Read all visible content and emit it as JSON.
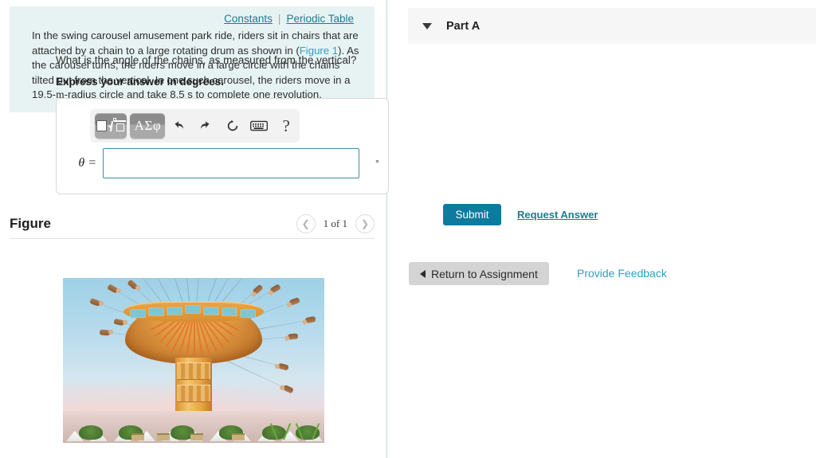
{
  "left_panel": {
    "top_links": [
      {
        "label": "Constants",
        "name": "constants-link"
      },
      {
        "label": "Periodic Table",
        "name": "periodic-table-link"
      }
    ],
    "separator": "|",
    "problem": {
      "part1": "In the swing carousel amusement park ride, riders sit in chairs that are attached by a chain to a large rotating drum as shown in (",
      "figure_link": "Figure 1",
      "part2": "). As the carousel turns, the riders move in a large circle with the chains tilted out from the vertical. In one such carousel, the riders move in a ",
      "radius_value": "19.5",
      "radius_unit": "m",
      "part3": "-radius circle and take ",
      "time_value": "8.5 s",
      "part4": " to complete one revolution."
    },
    "figure": {
      "title": "Figure",
      "prev_icon": "chevron-left-icon",
      "next_icon": "chevron-right-icon",
      "counter": "1 of 1",
      "image_alt": "swing carousel amusement park ride photograph"
    }
  },
  "right_panel": {
    "part": {
      "caret_icon": "caret-down-icon",
      "title": "Part A"
    },
    "question_text": "What is the angle of the chains, as measured from the vertical?",
    "instruction": "Express your answer in degrees.",
    "answer_widget": {
      "toolbar": [
        {
          "name": "math-template-button",
          "icon": "math-template-icon",
          "label": ""
        },
        {
          "name": "greek-symbols-button",
          "icon": "greek-letters-icon",
          "label": "ΑΣφ"
        },
        {
          "name": "undo-button",
          "icon": "undo-icon",
          "label": ""
        },
        {
          "name": "redo-button",
          "icon": "redo-icon",
          "label": ""
        },
        {
          "name": "reset-button",
          "icon": "reset-icon",
          "label": ""
        },
        {
          "name": "keyboard-button",
          "icon": "keyboard-icon",
          "label": ""
        },
        {
          "name": "help-button",
          "icon": "help-icon",
          "label": "?"
        }
      ],
      "variable_label": "θ =",
      "input_value": "",
      "input_placeholder": "",
      "unit": "°"
    },
    "submit_label": "Submit",
    "request_answer_label": "Request Answer",
    "return_label": "Return to Assignment",
    "return_icon": "chevron-left-icon",
    "feedback_label": "Provide Feedback"
  },
  "colors": {
    "problem_bg": "#e7f3f3",
    "link_teal": "#1a7b96",
    "accent_teal": "#2f9fc4",
    "submit_bg": "#0d7b9e",
    "part_header_bg": "#f6f6f6",
    "input_border": "#3f8ea8",
    "return_bg": "#d4d4d4"
  }
}
